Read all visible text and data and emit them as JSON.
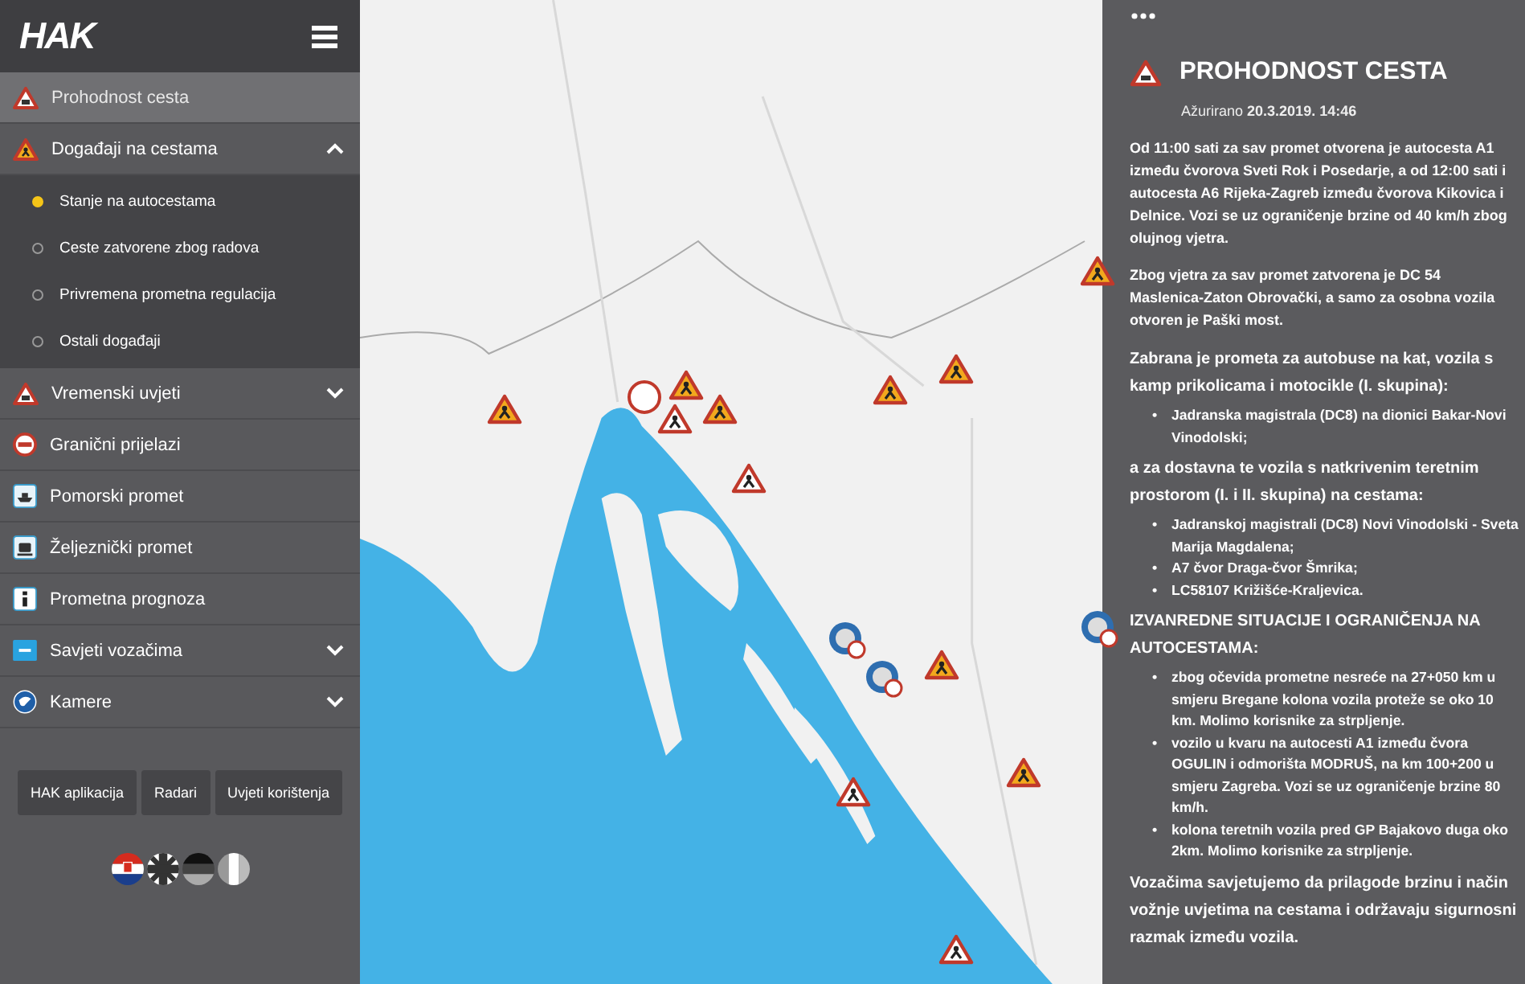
{
  "logo": "HAK",
  "menu": [
    {
      "label": "Prohodnost cesta",
      "selected": true
    },
    {
      "label": "Događaji na cestama",
      "selected": false,
      "expanded": true,
      "children": [
        {
          "label": "Stanje na autocestama",
          "selected": true
        },
        {
          "label": "Ceste zatvorene zbog radova",
          "selected": false
        },
        {
          "label": "Privremena prometna regulacija",
          "selected": false
        },
        {
          "label": "Ostali događaji",
          "selected": false
        }
      ]
    },
    {
      "label": "Vremenski uvjeti",
      "selected": false,
      "expanded": false
    },
    {
      "label": "Granični prijelazi",
      "selected": false
    },
    {
      "label": "Pomorski promet",
      "selected": false
    },
    {
      "label": "Željeznički promet",
      "selected": false
    },
    {
      "label": "Prometna prognoza",
      "selected": false
    },
    {
      "label": "Savjeti vozačima",
      "selected": false,
      "expanded": false
    },
    {
      "label": "Kamere",
      "selected": false,
      "expanded": false
    }
  ],
  "buttons": [
    "HAK aplikacija",
    "Radari",
    "Uvjeti korištenja"
  ],
  "panel": {
    "title": "PROHODNOST CESTA",
    "updated": "Ažurirano **20.3.2019. 14:46**",
    "blocks": [
      {
        "kind": "paragraph",
        "text": "Od 11:00 sati za sav promet otvorena je autocesta A1 između čvorova Sveti Rok i Posedarje, a od 12:00 sati i autocesta A6 Rijeka-Zagreb između čvorova Kikovica i Delnice. Vozi se uz ograničenje brzine od 40 km/h zbog olujnog vjetra."
      },
      {
        "kind": "paragraph",
        "text": "Zbog vjetra za sav promet zatvorena je DC 54 Maslenica-Zaton Obrovački, a samo za osobna vozila otvoren je Paški most."
      },
      {
        "kind": "heading",
        "text": "Zabrana je prometa za autobuse na kat, vozila s kamp prikolicama i motocikle (I. skupina):"
      },
      {
        "kind": "list",
        "marker": "•",
        "items": [
          "Jadranska magistrala (DC8) na dionici Bakar-Novi Vinodolski;"
        ]
      },
      {
        "kind": "heading",
        "text": "a za dostavna te vozila s natkrivenim teretnim prostorom (I. i II. skupina) na cestama:"
      },
      {
        "kind": "list",
        "marker": "•",
        "items": [
          "Jadranskoj magistrali (DC8) Novi Vinodolski - Sveta Marija Magdalena;",
          "A7 čvor Draga-čvor Šmrika;",
          "LC58107 Križišće-Kraljevica."
        ]
      },
      {
        "kind": "heading",
        "text": "IZVANREDNE SITUACIJE I OGRANIČENJA NA AUTOCESTAMA:"
      },
      {
        "kind": "list",
        "marker": "•",
        "items": [
          "zbog očevida prometne nesreće na 27+050 km u smjeru Bregane kolona vozila proteže se oko 10 km. Molimo korisnike za strpljenje.",
          "vozilo u kvaru na autocesti A1 između čvora OGULIN i odmorišta MODRUŠ, na km 100+200 u smjeru Zagreba. Vozi se uz ograničenje brzine 80 km/h.",
          "kolona teretnih vozila pred GP Bajakovo duga oko 2km. Molimo korisnike za strpljenje."
        ]
      },
      {
        "kind": "heading",
        "text": "Vozačima savjetujemo da prilagode brzinu i način vožnje uvjetima na cestama i održavaju sigurnosni razmak između vozila."
      }
    ]
  }
}
